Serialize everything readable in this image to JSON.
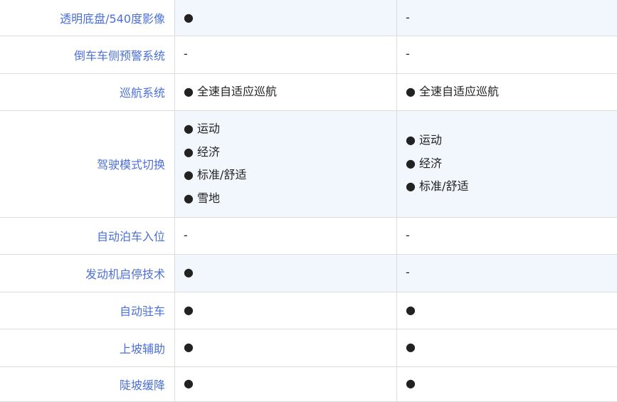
{
  "rows": [
    {
      "label": "透明底盘/540度影像",
      "shaded": true,
      "cells": [
        [
          "●"
        ],
        [
          "-"
        ]
      ]
    },
    {
      "label": "倒车车侧预警系统",
      "shaded": false,
      "cells": [
        [
          "-"
        ],
        [
          "-"
        ]
      ]
    },
    {
      "label": "巡航系统",
      "shaded": false,
      "cells": [
        [
          "● 全速自适应巡航"
        ],
        [
          "● 全速自适应巡航"
        ]
      ]
    },
    {
      "label": "驾驶模式切换",
      "shaded": true,
      "cells": [
        [
          "● 运动",
          "● 经济",
          "● 标准/舒适",
          "● 雪地"
        ],
        [
          "● 运动",
          "● 经济",
          "● 标准/舒适"
        ]
      ]
    },
    {
      "label": "自动泊车入位",
      "shaded": false,
      "cells": [
        [
          "-"
        ],
        [
          "-"
        ]
      ]
    },
    {
      "label": "发动机启停技术",
      "shaded": true,
      "cells": [
        [
          "●"
        ],
        [
          "-"
        ]
      ]
    },
    {
      "label": "自动驻车",
      "shaded": false,
      "cells": [
        [
          "●"
        ],
        [
          "●"
        ]
      ]
    },
    {
      "label": "上坡辅助",
      "shaded": false,
      "cells": [
        [
          "●"
        ],
        [
          "●"
        ]
      ]
    },
    {
      "label": "陡坡缓降",
      "shaded": false,
      "cells": [
        [
          "●"
        ],
        [
          "●"
        ]
      ]
    }
  ]
}
